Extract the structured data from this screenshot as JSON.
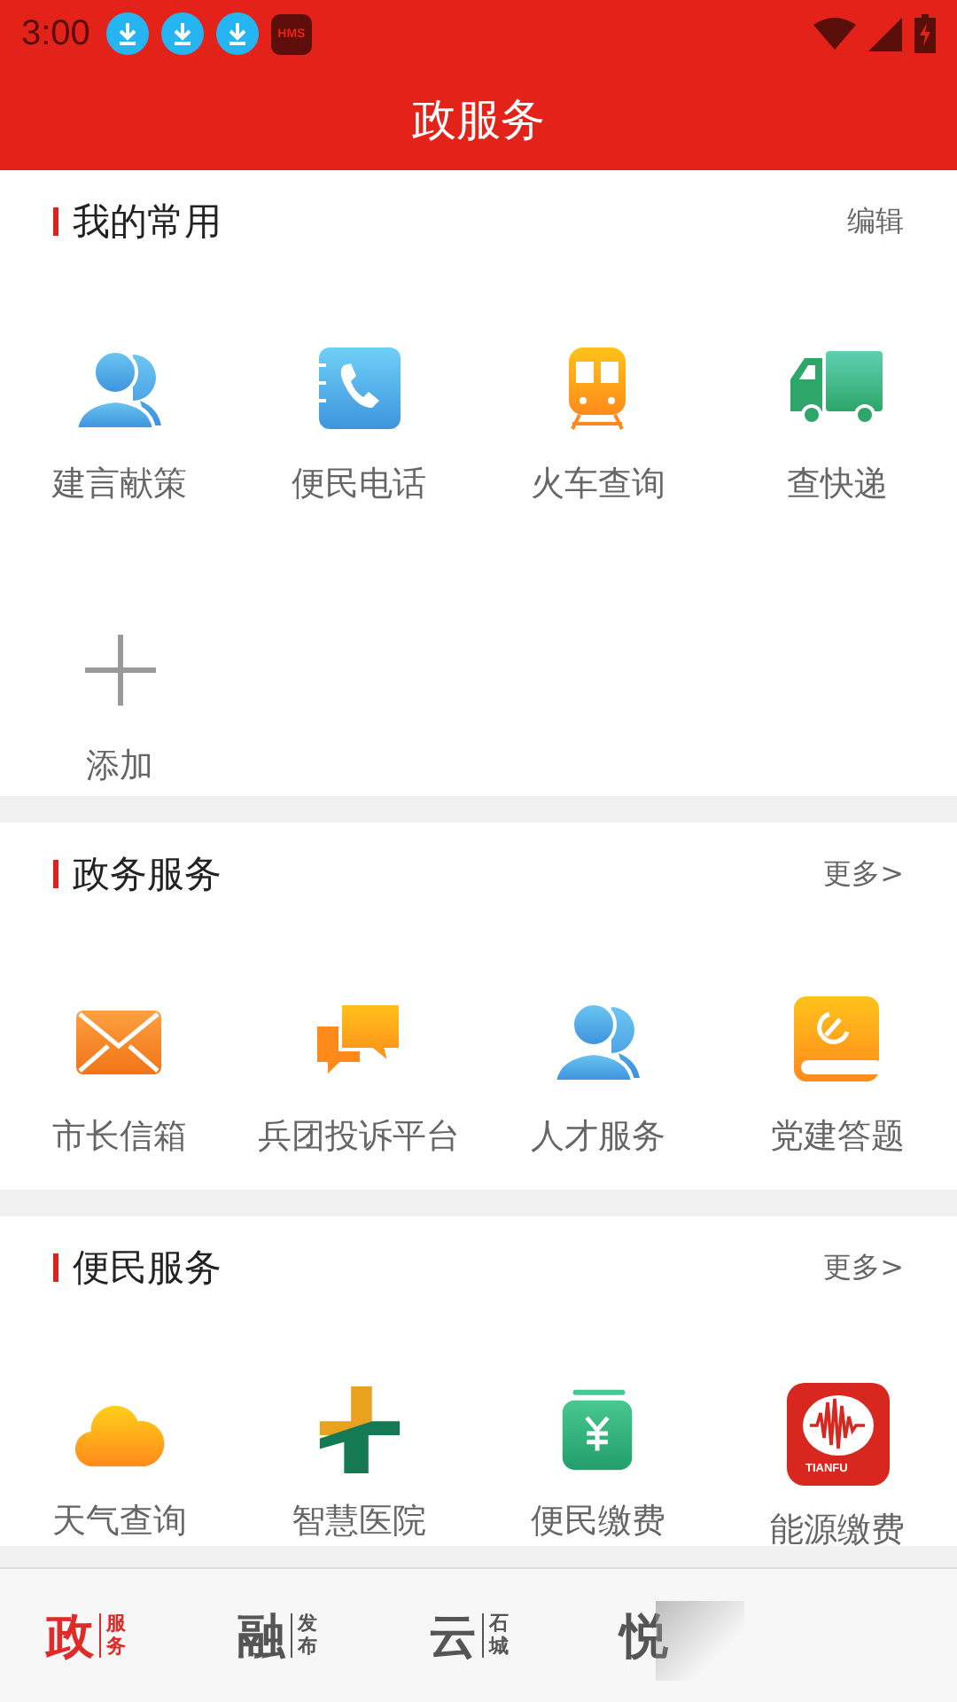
{
  "status_bar": {
    "time": "3:00",
    "notification_badge": "HMS"
  },
  "title_bar": {
    "title": "政服务"
  },
  "sections": [
    {
      "title": "我的常用",
      "action": "编辑",
      "items": [
        {
          "kind": "service",
          "label": "建言献策"
        },
        {
          "kind": "service",
          "label": "便民电话"
        },
        {
          "kind": "service",
          "label": "火车查询"
        },
        {
          "kind": "service",
          "label": "查快递"
        },
        {
          "kind": "add",
          "label": "添加"
        }
      ]
    },
    {
      "title": "政务服务",
      "action": "更多>",
      "items": [
        {
          "kind": "service",
          "label": "市长信箱"
        },
        {
          "kind": "service",
          "label": "兵团投诉平台"
        },
        {
          "kind": "service",
          "label": "人才服务"
        },
        {
          "kind": "service",
          "label": "党建答题"
        }
      ]
    },
    {
      "title": "便民服务",
      "action": "更多>",
      "items": [
        {
          "kind": "service",
          "label": "天气查询"
        },
        {
          "kind": "service",
          "label": "智慧医院"
        },
        {
          "kind": "service",
          "label": "便民缴费"
        },
        {
          "kind": "service",
          "label": "能源缴费",
          "icon_text": "TIANFU"
        }
      ]
    }
  ],
  "bottom_nav": [
    {
      "main": "政",
      "sub": [
        "服",
        "务"
      ],
      "selected": true
    },
    {
      "main": "融",
      "sub": [
        "发",
        "布"
      ],
      "selected": false
    },
    {
      "main": "云",
      "sub": [
        "石",
        "城"
      ],
      "selected": false
    },
    {
      "main": "悦",
      "selected": false
    }
  ]
}
